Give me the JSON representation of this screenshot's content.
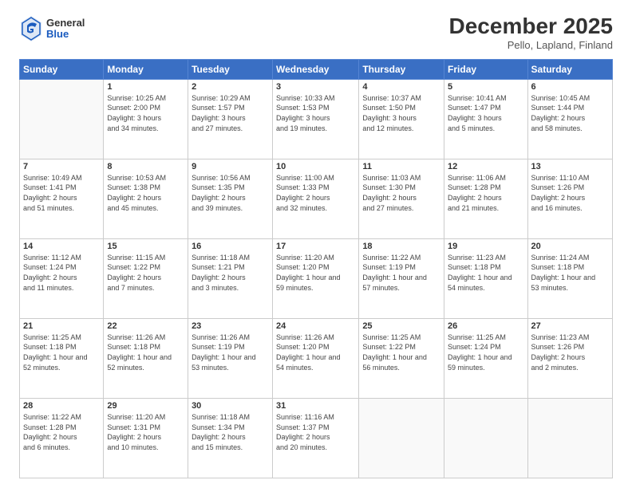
{
  "header": {
    "logo_line1": "General",
    "logo_line2": "Blue",
    "title": "December 2025",
    "subtitle": "Pello, Lapland, Finland"
  },
  "days_of_week": [
    "Sunday",
    "Monday",
    "Tuesday",
    "Wednesday",
    "Thursday",
    "Friday",
    "Saturday"
  ],
  "weeks": [
    [
      {
        "day": "",
        "info": ""
      },
      {
        "day": "1",
        "info": "Sunrise: 10:25 AM\nSunset: 2:00 PM\nDaylight: 3 hours\nand 34 minutes."
      },
      {
        "day": "2",
        "info": "Sunrise: 10:29 AM\nSunset: 1:57 PM\nDaylight: 3 hours\nand 27 minutes."
      },
      {
        "day": "3",
        "info": "Sunrise: 10:33 AM\nSunset: 1:53 PM\nDaylight: 3 hours\nand 19 minutes."
      },
      {
        "day": "4",
        "info": "Sunrise: 10:37 AM\nSunset: 1:50 PM\nDaylight: 3 hours\nand 12 minutes."
      },
      {
        "day": "5",
        "info": "Sunrise: 10:41 AM\nSunset: 1:47 PM\nDaylight: 3 hours\nand 5 minutes."
      },
      {
        "day": "6",
        "info": "Sunrise: 10:45 AM\nSunset: 1:44 PM\nDaylight: 2 hours\nand 58 minutes."
      }
    ],
    [
      {
        "day": "7",
        "info": "Sunrise: 10:49 AM\nSunset: 1:41 PM\nDaylight: 2 hours\nand 51 minutes."
      },
      {
        "day": "8",
        "info": "Sunrise: 10:53 AM\nSunset: 1:38 PM\nDaylight: 2 hours\nand 45 minutes."
      },
      {
        "day": "9",
        "info": "Sunrise: 10:56 AM\nSunset: 1:35 PM\nDaylight: 2 hours\nand 39 minutes."
      },
      {
        "day": "10",
        "info": "Sunrise: 11:00 AM\nSunset: 1:33 PM\nDaylight: 2 hours\nand 32 minutes."
      },
      {
        "day": "11",
        "info": "Sunrise: 11:03 AM\nSunset: 1:30 PM\nDaylight: 2 hours\nand 27 minutes."
      },
      {
        "day": "12",
        "info": "Sunrise: 11:06 AM\nSunset: 1:28 PM\nDaylight: 2 hours\nand 21 minutes."
      },
      {
        "day": "13",
        "info": "Sunrise: 11:10 AM\nSunset: 1:26 PM\nDaylight: 2 hours\nand 16 minutes."
      }
    ],
    [
      {
        "day": "14",
        "info": "Sunrise: 11:12 AM\nSunset: 1:24 PM\nDaylight: 2 hours\nand 11 minutes."
      },
      {
        "day": "15",
        "info": "Sunrise: 11:15 AM\nSunset: 1:22 PM\nDaylight: 2 hours\nand 7 minutes."
      },
      {
        "day": "16",
        "info": "Sunrise: 11:18 AM\nSunset: 1:21 PM\nDaylight: 2 hours\nand 3 minutes."
      },
      {
        "day": "17",
        "info": "Sunrise: 11:20 AM\nSunset: 1:20 PM\nDaylight: 1 hour and\n59 minutes."
      },
      {
        "day": "18",
        "info": "Sunrise: 11:22 AM\nSunset: 1:19 PM\nDaylight: 1 hour and\n57 minutes."
      },
      {
        "day": "19",
        "info": "Sunrise: 11:23 AM\nSunset: 1:18 PM\nDaylight: 1 hour and\n54 minutes."
      },
      {
        "day": "20",
        "info": "Sunrise: 11:24 AM\nSunset: 1:18 PM\nDaylight: 1 hour and\n53 minutes."
      }
    ],
    [
      {
        "day": "21",
        "info": "Sunrise: 11:25 AM\nSunset: 1:18 PM\nDaylight: 1 hour and\n52 minutes."
      },
      {
        "day": "22",
        "info": "Sunrise: 11:26 AM\nSunset: 1:18 PM\nDaylight: 1 hour and\n52 minutes."
      },
      {
        "day": "23",
        "info": "Sunrise: 11:26 AM\nSunset: 1:19 PM\nDaylight: 1 hour and\n53 minutes."
      },
      {
        "day": "24",
        "info": "Sunrise: 11:26 AM\nSunset: 1:20 PM\nDaylight: 1 hour and\n54 minutes."
      },
      {
        "day": "25",
        "info": "Sunrise: 11:25 AM\nSunset: 1:22 PM\nDaylight: 1 hour and\n56 minutes."
      },
      {
        "day": "26",
        "info": "Sunrise: 11:25 AM\nSunset: 1:24 PM\nDaylight: 1 hour and\n59 minutes."
      },
      {
        "day": "27",
        "info": "Sunrise: 11:23 AM\nSunset: 1:26 PM\nDaylight: 2 hours\nand 2 minutes."
      }
    ],
    [
      {
        "day": "28",
        "info": "Sunrise: 11:22 AM\nSunset: 1:28 PM\nDaylight: 2 hours\nand 6 minutes."
      },
      {
        "day": "29",
        "info": "Sunrise: 11:20 AM\nSunset: 1:31 PM\nDaylight: 2 hours\nand 10 minutes."
      },
      {
        "day": "30",
        "info": "Sunrise: 11:18 AM\nSunset: 1:34 PM\nDaylight: 2 hours\nand 15 minutes."
      },
      {
        "day": "31",
        "info": "Sunrise: 11:16 AM\nSunset: 1:37 PM\nDaylight: 2 hours\nand 20 minutes."
      },
      {
        "day": "",
        "info": ""
      },
      {
        "day": "",
        "info": ""
      },
      {
        "day": "",
        "info": ""
      }
    ]
  ]
}
